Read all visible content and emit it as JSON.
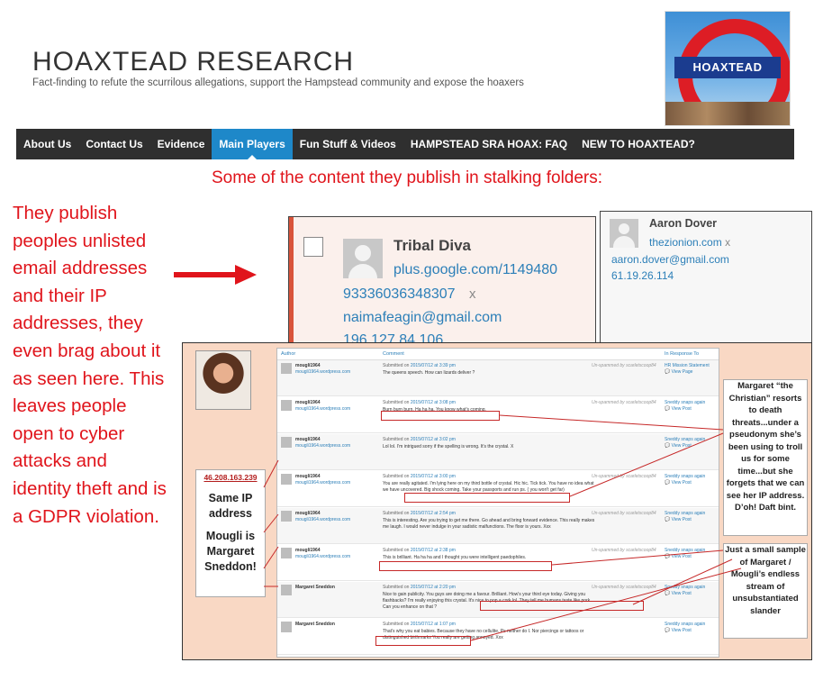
{
  "site": {
    "title": "HOAXTEAD RESEARCH",
    "tagline": "Fact-finding to refute the scurrilous allegations, support the Hampstead community and expose the hoaxers",
    "logo_text": "HOAXTEAD"
  },
  "nav": {
    "items": [
      "About Us",
      "Contact Us",
      "Evidence",
      "Main Players",
      "Fun Stuff & Videos",
      "HAMPSTEAD SRA HOAX: FAQ",
      "NEW TO HOAXTEAD?"
    ],
    "active": "Main Players"
  },
  "headline": "Some of the content they publish in stalking folders:",
  "side_text": "They publish peoples unlisted email addresses and their IP addresses, they even brag about it as seen here. This leaves people open to cyber attacks and identity theft and is a GDPR violation.",
  "shot1": {
    "name": "Tribal Diva",
    "url_line1": "plus.google.com/1149480",
    "url_line2": "93336036348307",
    "remove_mark": "x",
    "email": "naimafeagin@gmail.com",
    "ip": "196.127.84.106"
  },
  "shot2": {
    "name": "Aaron Dover",
    "url": "thezionion.com",
    "remove_mark": "x",
    "email": "aaron.dover@gmail.com",
    "ip": "61.19.26.114"
  },
  "panel": {
    "ip_label": "46.208.163.239",
    "same_ip": "Same IP address",
    "identity": "Mougli is Margaret Sneddon!",
    "columns": [
      "Author",
      "Comment",
      "In Response To"
    ],
    "view_label": "View Post",
    "rows": [
      {
        "author": "mougli1964",
        "site": "mougli1964.wordpress.com",
        "submitted": "Submitted on",
        "date": "2015/07/12 at 3:39 pm",
        "text": "The queens speech. How can lizards deliver ?",
        "unspam": "Un-spammed by scarletscoop84",
        "response": "HR Mission Statement",
        "view": "View Page"
      },
      {
        "author": "mougli1964",
        "site": "mougli1964.wordpress.com",
        "submitted": "Submitted on",
        "date": "2015/07/12 at 3:08 pm",
        "text": "Burn burn burn. Ha ha ha. You know what's coming.",
        "unspam": "Un-spammed by scarletscoop84",
        "response": "Sneddy snaps again",
        "view": "View Post"
      },
      {
        "author": "mougli1964",
        "site": "mougli1964.wordpress.com",
        "submitted": "Submitted on",
        "date": "2015/07/12 at 3:02 pm",
        "text": "Lol lol. I'm intrigued sorry if the spelling is wrong. It's the crystal. X",
        "unspam": "",
        "response": "Sneddy snaps again",
        "view": "View Post"
      },
      {
        "author": "mougli1964",
        "site": "mougli1964.wordpress.com",
        "submitted": "Submitted on",
        "date": "2015/07/12 at 3:00 pm",
        "text": "You are really agitated. I'm lying here on my third bottle of crystal. Hic hic. Tick tick. You have no idea what we have uncovered. Big shock coming. Take your passports and run ps. ( you won't get far)",
        "unspam": "Un-spammed by scarletscoop84",
        "response": "Sneddy snaps again",
        "view": "View Post"
      },
      {
        "author": "mougli1964",
        "site": "mougli1964.wordpress.com",
        "submitted": "Submitted on",
        "date": "2015/07/12 at 2:54 pm",
        "text": "This is interesting. Are you trying to get me there. Go ahead and bring forward evidence. This really makes me laugh. I would never indulge in your sadistic malfunctions. The floor is yours. Xxx",
        "unspam": "Un-spammed by scarletscoop84",
        "response": "Sneddy snaps again",
        "view": "View Post"
      },
      {
        "author": "mougli1964",
        "site": "mougli1964.wordpress.com",
        "submitted": "Submitted on",
        "date": "2015/07/12 at 2:38 pm",
        "text": "This is brilliant. Ha ha ha and I thought you were intelligent paedophiles.",
        "unspam": "Un-spammed by scarletscoop84",
        "response": "Sneddy snaps again",
        "view": "View Post"
      },
      {
        "author": "Margaret Sneddon",
        "site": "",
        "submitted": "Submitted on",
        "date": "2015/07/12 at 2:20 pm",
        "text": "Nice to gain publicity. You guys are doing me a favour. Brilliant. How's your third eye today. Giving you flashbacks? I'm really enjoying this crystal. It's nice to pop a cork lol. They tell me humans taste like pork. Can you enhance on that ?",
        "unspam": "Un-spammed by scarletscoop84",
        "response": "Sneddy snaps again",
        "view": "View Post"
      },
      {
        "author": "Margaret Sneddon",
        "site": "",
        "submitted": "Submitted on",
        "date": "2015/07/12 at 1:07 pm",
        "text": "That's why you eat babies. Because they have no cellulite. Ps neither do I. Nor piercings or tattoos or distinguished birthmarks You really are getting annoyed. Xxx",
        "unspam": "",
        "response": "Sneddy snaps again",
        "view": "View Post"
      }
    ],
    "note1": "Margaret “the Christian” resorts to death threats...under a pseudonym she’s been using to troll us for some time...but she forgets that we can see her IP address. D’oh! Daft bint.",
    "note2": "Just a small sample of Margaret / Mougli’s endless stream of unsubstantiated slander"
  },
  "colors": {
    "accent_red": "#e0141b",
    "nav_bg": "#2f2f2f",
    "nav_active": "#1e88c9",
    "panel_bg": "#f9d8c4",
    "link": "#2c7fb8"
  },
  "icons": [
    "checkbox-icon",
    "avatar-icon",
    "speech-bubble-icon",
    "arrow-right-icon"
  ]
}
